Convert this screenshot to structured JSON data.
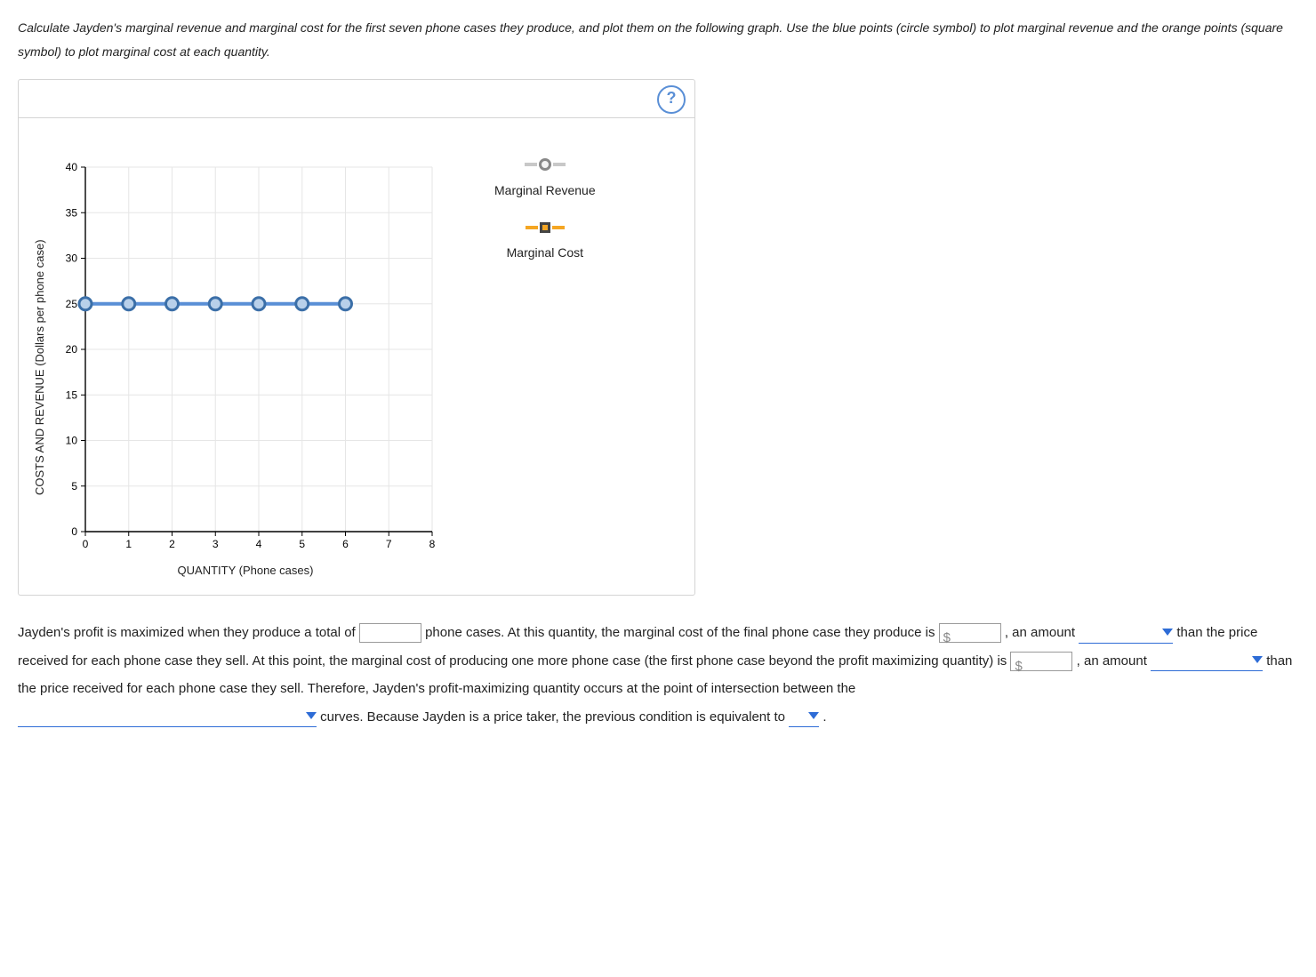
{
  "prompt_text": "Calculate Jayden's marginal revenue and marginal cost for the first seven phone cases they produce, and plot them on the following graph. Use the blue points (circle symbol) to plot marginal revenue and the orange points (square symbol) to plot marginal cost at each quantity.",
  "help_icon": "?",
  "legend": {
    "mr": "Marginal Revenue",
    "mc": "Marginal Cost"
  },
  "chart_data": {
    "type": "scatter",
    "xlabel": "QUANTITY (Phone cases)",
    "ylabel": "COSTS AND REVENUE (Dollars per phone case)",
    "xlim": [
      0,
      8
    ],
    "ylim": [
      0,
      40
    ],
    "xticks": [
      0,
      1,
      2,
      3,
      4,
      5,
      6,
      7,
      8
    ],
    "yticks": [
      0,
      5,
      10,
      15,
      20,
      25,
      30,
      35,
      40
    ],
    "series": [
      {
        "name": "Marginal Revenue",
        "symbol": "circle",
        "color_line": "#5a8fd6",
        "color_fill": "#b8d0ea",
        "color_stroke": "#3b6fa8",
        "x": [
          0,
          1,
          2,
          3,
          4,
          5,
          6
        ],
        "y": [
          25,
          25,
          25,
          25,
          25,
          25,
          25
        ]
      },
      {
        "name": "Marginal Cost",
        "symbol": "square",
        "color_line": "#f5a623",
        "color_fill": "#f5a623",
        "color_stroke": "#444444",
        "x": [],
        "y": []
      }
    ]
  },
  "question": {
    "p1a": "Jayden's profit is maximized when they produce a total of ",
    "p1b": " phone cases. At this quantity, the marginal cost of the final phone case they produce is ",
    "p1c": ", an amount ",
    "p1d": " than the price received for each phone case they sell. At this point, the marginal cost of producing one more phone case (the first phone case beyond the profit maximizing quantity) is ",
    "p1e": ", an amount ",
    "p1f": " than the price received for each phone case they sell. Therefore, Jayden's profit-maximizing quantity occurs at the point of intersection between the ",
    "p1g": " curves. Because Jayden is a price taker, the previous condition is equivalent to ",
    "p1h": " .",
    "dollar": "$"
  }
}
